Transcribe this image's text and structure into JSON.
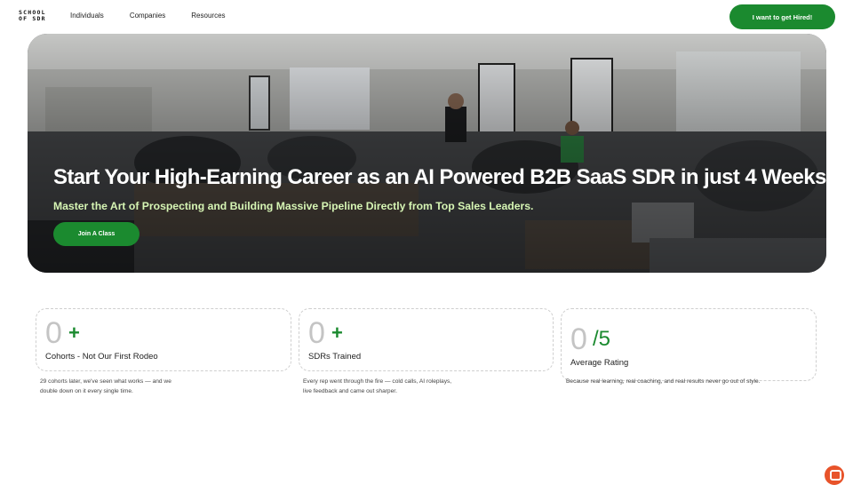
{
  "brand": {
    "logo_line1": "SCHOOL",
    "logo_line2": "OF SDR"
  },
  "nav": {
    "links": [
      "Individuals",
      "Companies",
      "Resources"
    ],
    "cta_label": "I want to get Hired!"
  },
  "hero": {
    "title": "Start Your High-Earning Career as an AI Powered B2B SaaS SDR in just 4 Weeks",
    "subtitle": "Master the Art of Prospecting and Building Massive Pipeline  Directly from Top Sales Leaders.",
    "button_label": "Join A Class"
  },
  "stats": [
    {
      "value": "0",
      "suffix": "+",
      "label": "Cohorts - Not Our First Rodeo",
      "description": "29 cohorts later, we've seen what works — and we double down on it every single time."
    },
    {
      "value": "0",
      "suffix": "+",
      "label": "SDRs Trained",
      "description": "Every rep went through the fire — cold calls, AI roleplays, live feedback and came out sharper."
    },
    {
      "value": "0",
      "suffix": "/5",
      "label": "Average Rating",
      "description": "Because real learning, real coaching, and real results never go out of style."
    }
  ],
  "colors": {
    "brand_green": "#1b8a2f",
    "subtitle_green": "#d6f5b4",
    "chat_orange": "#e8532a"
  },
  "icons": {
    "chat": "chat-bubble-icon"
  }
}
